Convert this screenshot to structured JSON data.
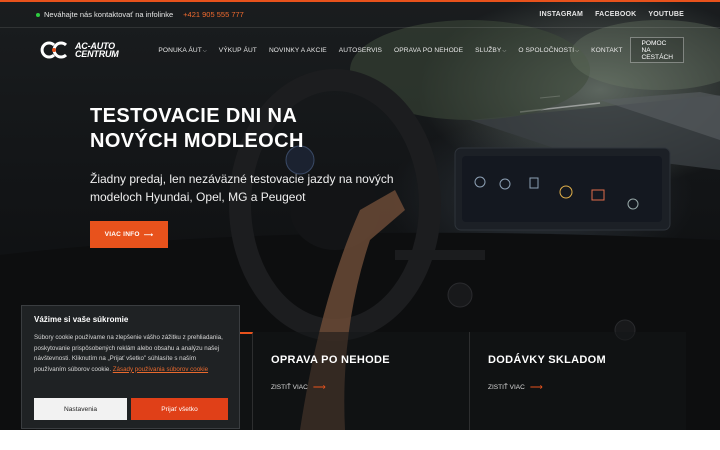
{
  "topbar": {
    "info_text": "Neváhajte nás kontaktovať na infolinke",
    "phone": "+421 905 555 777",
    "socials": [
      "INSTAGRAM",
      "FACEBOOK",
      "YOUTUBE"
    ]
  },
  "nav": {
    "logo_line1": "AC-AUTO",
    "logo_line2": "CENTRUM",
    "items": [
      {
        "label": "PONUKA ÁUT",
        "dropdown": true
      },
      {
        "label": "VÝKUP ÁUT",
        "dropdown": false
      },
      {
        "label": "NOVINKY A AKCIE",
        "dropdown": false
      },
      {
        "label": "AUTOSERVIS",
        "dropdown": false
      },
      {
        "label": "OPRAVA PO NEHODE",
        "dropdown": false
      },
      {
        "label": "SLUŽBY",
        "dropdown": true
      },
      {
        "label": "O SPOLOČNOSTI",
        "dropdown": true
      },
      {
        "label": "KONTAKT",
        "dropdown": false
      }
    ],
    "help_button": "POMOC NA CESTÁCH"
  },
  "hero": {
    "title_line1": "TESTOVACIE DNI NA",
    "title_line2": "NOVÝCH MODLEOCH",
    "subtitle": "Žiadny predaj, len nezáväzné testovacie jazdy na nových modeloch Hyundai, Opel, MG a Peugeot",
    "cta_label": "VIAC INFO"
  },
  "cards": [
    {
      "title": "",
      "link": ""
    },
    {
      "title": "OPRAVA PO NEHODE",
      "link": "ZISTIŤ VIAC"
    },
    {
      "title": "DODÁVKY SKLADOM",
      "link": "ZISTIŤ VIAC"
    }
  ],
  "cookie": {
    "title": "Vážime si vaše súkromie",
    "text": "Súbory cookie používame na zlepšenie vášho zážitku z prehliadania, poskytovanie prispôsobených reklám alebo obsahu a analýzu našej návštevnosti. Kliknutím na „Prijať všetko\" súhlasíte s naším používaním súborov cookie.",
    "policy_link": "Zásady používania súborov cookie",
    "settings_button": "Nastavenia",
    "accept_button": "Prijať všetko"
  },
  "colors": {
    "accent": "#e8521c",
    "online_dot": "#2ecc40",
    "dark_bg": "#121416"
  },
  "icons": {
    "logo": "ac-logo-icon",
    "arrow": "arrow-right-icon",
    "dropdown": "chevron-down-icon"
  }
}
